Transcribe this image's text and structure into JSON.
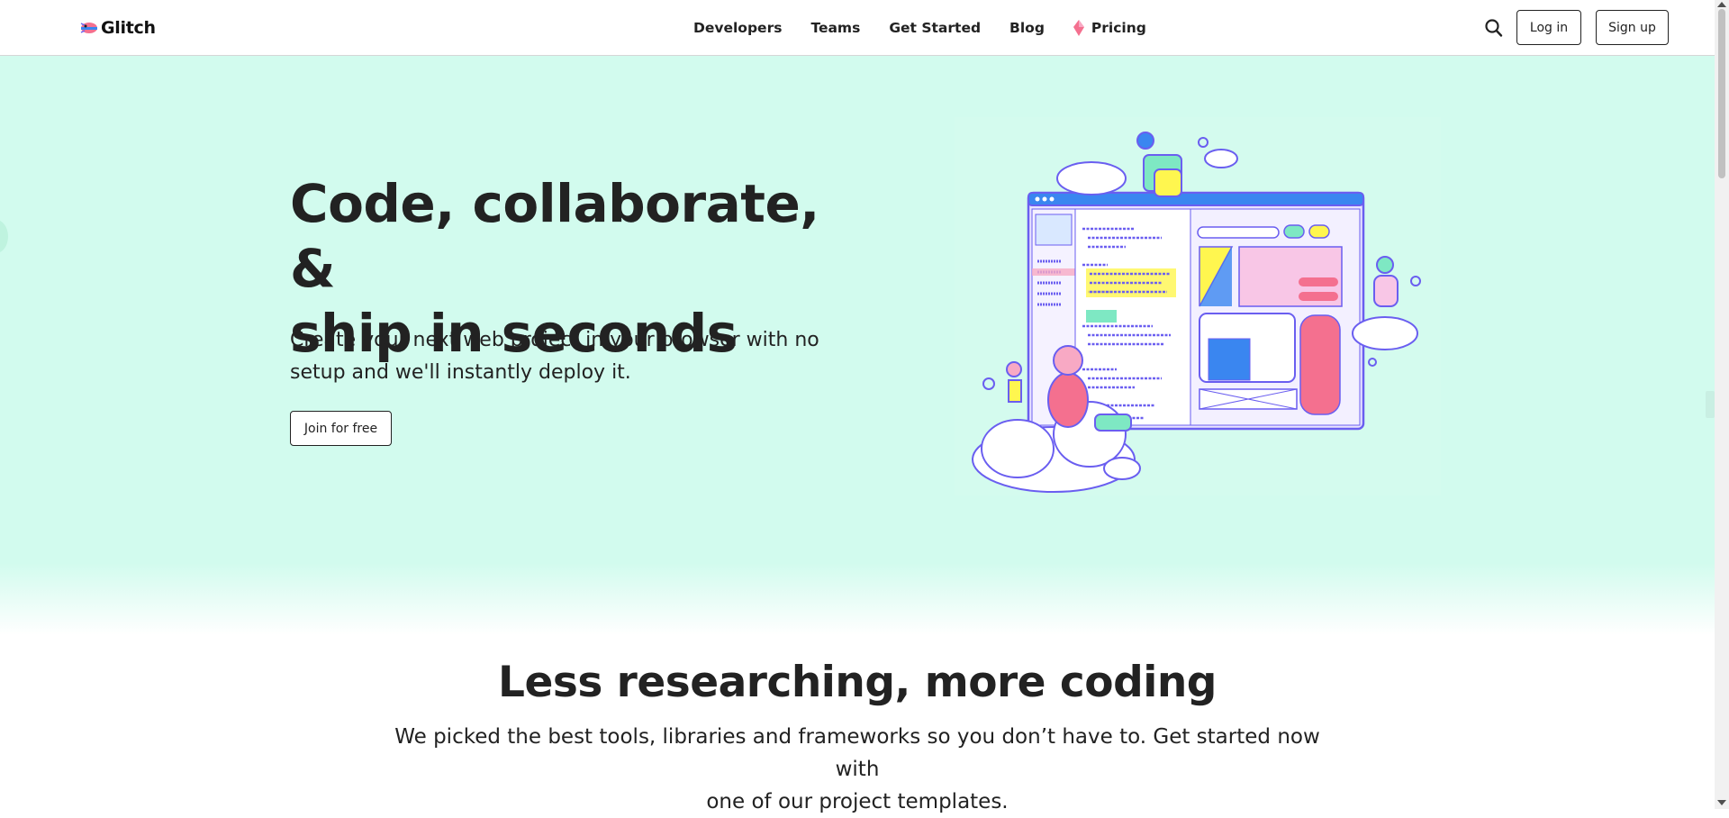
{
  "header": {
    "logo_text": "Glitch",
    "nav": [
      {
        "label": "Developers"
      },
      {
        "label": "Teams"
      },
      {
        "label": "Get Started"
      },
      {
        "label": "Blog"
      },
      {
        "label": "Pricing",
        "icon": "gem-icon"
      }
    ],
    "search_icon": "search-icon",
    "login_label": "Log in",
    "signup_label": "Sign up"
  },
  "hero": {
    "title_line1": "Code, collaborate, &",
    "title_line2": "ship in seconds",
    "subtitle_line1": "Create your next web project in your browser with no",
    "subtitle_line2": "setup and we'll instantly deploy it.",
    "cta_label": "Join for free",
    "background": "#d2fbee"
  },
  "section": {
    "title": "Less researching, more coding",
    "subtitle_line1": "We picked the best tools, libraries and frameworks so you don’t have to. Get started now with",
    "subtitle_line2": "one of our project templates."
  },
  "colors": {
    "accent_pink": "#f4708f",
    "accent_blue": "#3a86f0",
    "accent_yellow": "#fff64f",
    "outline_purple": "#6a5ef0"
  }
}
